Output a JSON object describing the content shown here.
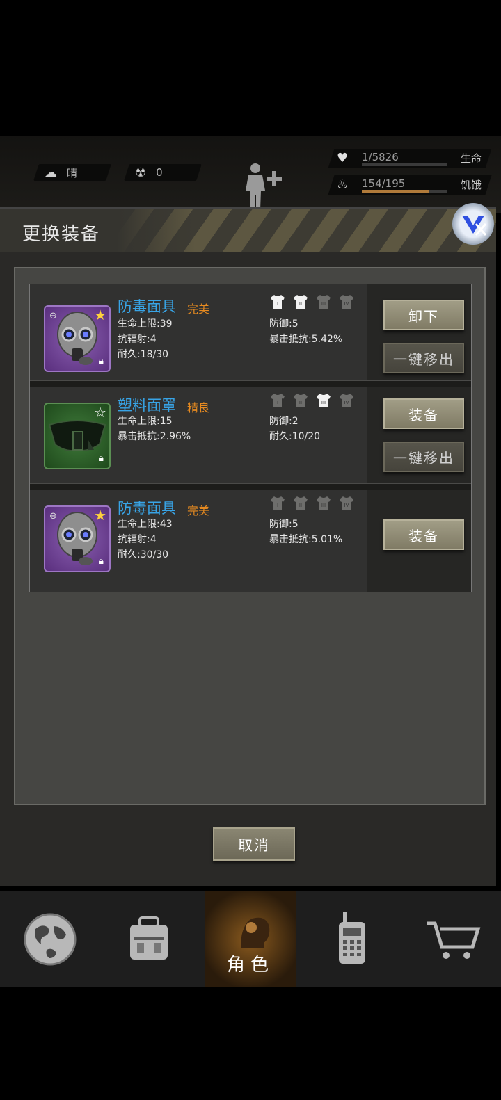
{
  "status": {
    "weather_label": "晴",
    "radiation_value": "0",
    "health_value": "1/5826",
    "health_label": "生命",
    "health_fill": 0.0002,
    "hunger_value": "154/195",
    "hunger_label": "饥饿",
    "hunger_fill": 0.79
  },
  "modal": {
    "title": "更换装备",
    "cancel_label": "取消"
  },
  "items": [
    {
      "name": "防毒面具",
      "grade": "完美",
      "stats_left": [
        "生命上限:39",
        "抗辐射:4",
        "耐久:18/30"
      ],
      "stats_right": [
        "防御:5",
        "暴击抵抗:5.42%"
      ],
      "slots": [
        "I",
        "II",
        "III",
        "IV"
      ],
      "slots_lit": [
        true,
        true,
        false,
        false
      ],
      "actions": [
        "卸下",
        "一键移出"
      ]
    },
    {
      "name": "塑料面罩",
      "grade": "精良",
      "stats_left": [
        "生命上限:15",
        "暴击抵抗:2.96%"
      ],
      "stats_right": [
        "防御:2",
        "耐久:10/20"
      ],
      "slots": [
        "I",
        "II",
        "III",
        "IV"
      ],
      "slots_lit": [
        false,
        false,
        true,
        false
      ],
      "actions": [
        "装备",
        "一键移出"
      ]
    },
    {
      "name": "防毒面具",
      "grade": "完美",
      "stats_left": [
        "生命上限:43",
        "抗辐射:4",
        "耐久:30/30"
      ],
      "stats_right": [
        "防御:5",
        "暴击抵抗:5.01%"
      ],
      "slots": [
        "I",
        "II",
        "III",
        "IV"
      ],
      "slots_lit": [
        false,
        false,
        false,
        false
      ],
      "actions": [
        "装备"
      ]
    }
  ],
  "nav": {
    "active_label": "角色"
  },
  "colors": {
    "item_name": "#38a4e6",
    "grade": "#e68a20",
    "accent_orange": "#8a5a1e"
  }
}
